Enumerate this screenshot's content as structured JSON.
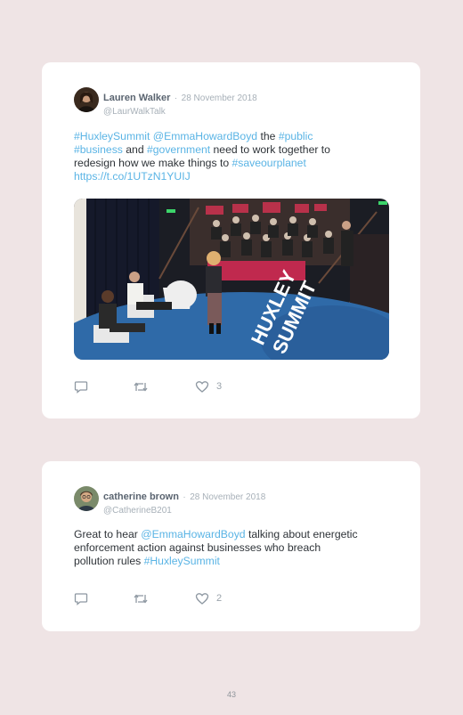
{
  "tweets": [
    {
      "author": "Lauren Walker",
      "separator": "·",
      "date": "28 November 2018",
      "handle": "@LaurWalkTalk",
      "text": {
        "l1a": "#HuxleySummit @EmmaHowardBoyd",
        "l1b": " the ",
        "l1c": "#public",
        "l2a": "#business",
        "l2b": " and ",
        "l2c": "#government",
        "l2d": " need to work together to",
        "l3a": "redesign how we make things to ",
        "l3b": "#saveourplanet",
        "l4": "https://t.co/1UTzN1YUIJ"
      },
      "stage_text": "HUXLEY SUMMIT",
      "reply_icon": "reply-icon",
      "retweet_icon": "retweet-icon",
      "like_icon": "heart-icon",
      "likes": "3"
    },
    {
      "author": "catherine brown",
      "separator": "·",
      "date": "28 November 2018",
      "handle": "@CatherineB201",
      "text": {
        "l1a": "Great to hear ",
        "l1b": "@EmmaHowardBoyd",
        "l1c": " talking about energetic",
        "l2": "enforcement action against businesses who breach",
        "l3a": "pollution rules ",
        "l3b": "#HuxleySummit"
      },
      "reply_icon": "reply-icon",
      "retweet_icon": "retweet-icon",
      "like_icon": "heart-icon",
      "likes": "2"
    }
  ],
  "page_number": "43",
  "colors": {
    "background": "#efe4e5",
    "card": "#ffffff",
    "link": "#5ab4e5",
    "muted": "#a7b0b8"
  }
}
